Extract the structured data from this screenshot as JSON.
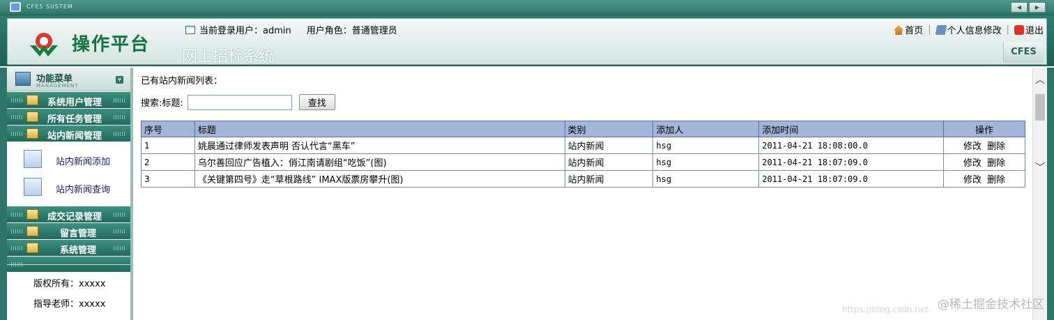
{
  "titlebar": {
    "app_name": "CFES SUSTEM",
    "prev": "◀",
    "next": "▶"
  },
  "header": {
    "logo_text": "操作平台",
    "subtitle": "网上招标系统",
    "user_label": "当前登录用户：admin",
    "role_label": "用户角色：普通管理员",
    "links": {
      "home": "首页",
      "profile": "个人信息修改",
      "logout": "退出"
    },
    "badge": "CFES"
  },
  "sidebar": {
    "title": "功能菜单",
    "subtitle": "MANAGEMENT",
    "toggle": "¥",
    "items": [
      {
        "label": "系统用户管理"
      },
      {
        "label": "所有任务管理"
      },
      {
        "label": "站内新闻管理"
      }
    ],
    "subitems": [
      {
        "label": "站内新闻添加"
      },
      {
        "label": "站内新闻查询"
      }
    ],
    "items_after": [
      {
        "label": "成交记录管理"
      },
      {
        "label": "留言管理"
      },
      {
        "label": "系统管理"
      }
    ],
    "copyright": "版权所有：xxxxx",
    "teacher": "指导老师：xxxxx"
  },
  "main": {
    "list_title": "已有站内新闻列表：",
    "search_label": "搜索:标题:",
    "search_value": "",
    "search_button": "查找",
    "columns": [
      "序号",
      "标题",
      "类别",
      "添加人",
      "添加时间",
      "操作"
    ],
    "rows": [
      {
        "no": "1",
        "title": "姚晨通过律师发表声明 否认代言“黑车”",
        "category": "站内新闻",
        "author": "hsg",
        "time": "2011-04-21 18:08:00.0",
        "edit": "修改",
        "delete": "删除"
      },
      {
        "no": "2",
        "title": "乌尔善回应广告植入：俏江南请剧组“吃饭”(图)",
        "category": "站内新闻",
        "author": "hsg",
        "time": "2011-04-21 18:07:09.0",
        "edit": "修改",
        "delete": "删除"
      },
      {
        "no": "3",
        "title": "《关键第四号》走“草根路线” IMAX版票房攀升(图)",
        "category": "站内新闻",
        "author": "hsg",
        "time": "2011-04-21 18:07:09.0",
        "edit": "修改",
        "delete": "删除"
      }
    ]
  },
  "watermark": {
    "text": "@稀土掘金技术社区",
    "url": "https://blog.csdn.net"
  }
}
